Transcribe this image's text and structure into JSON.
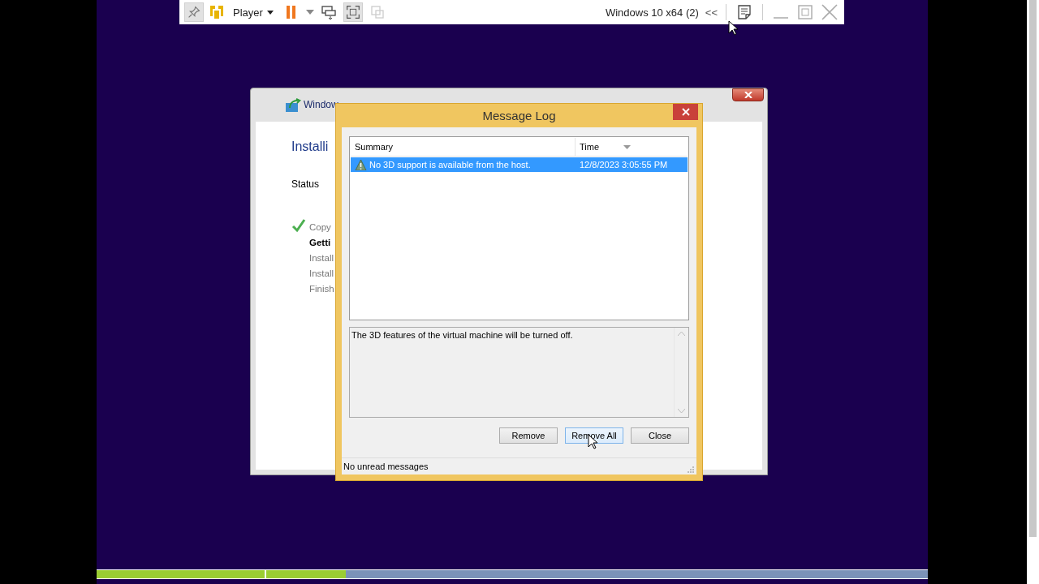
{
  "toolbar": {
    "menu": "Player",
    "vm_name": "Windows 10 x64 (2)",
    "collapse": "<<",
    "pin_selected": true,
    "fullscreen_selected": true,
    "unity_disabled": true
  },
  "setup_window": {
    "title": "Window",
    "heading": "Installi",
    "status_label": "Status",
    "steps": [
      {
        "text": "Copy",
        "done": true,
        "current": false
      },
      {
        "text": "Getti",
        "done": false,
        "current": true
      },
      {
        "text": "Install",
        "done": false,
        "current": false
      },
      {
        "text": "Install",
        "done": false,
        "current": false
      },
      {
        "text": "Finish",
        "done": false,
        "current": false
      }
    ]
  },
  "message_log": {
    "title": "Message Log",
    "columns": [
      {
        "label": "Summary",
        "sorted": false
      },
      {
        "label": "Time",
        "sorted": true
      }
    ],
    "rows": [
      {
        "summary": "No 3D support is available from the host.",
        "time": "12/8/2023 3:05:55 PM",
        "kind": "warning",
        "selected": true
      }
    ],
    "detail": "The 3D features of the virtual machine will be turned off.",
    "buttons": [
      {
        "label": "Remove",
        "hovered": false
      },
      {
        "label": "Remove All",
        "hovered": true
      },
      {
        "label": "Close",
        "hovered": false
      }
    ],
    "status": "No unread messages"
  },
  "progress": [
    {
      "level": 1
    },
    {
      "level": 0.12
    }
  ]
}
